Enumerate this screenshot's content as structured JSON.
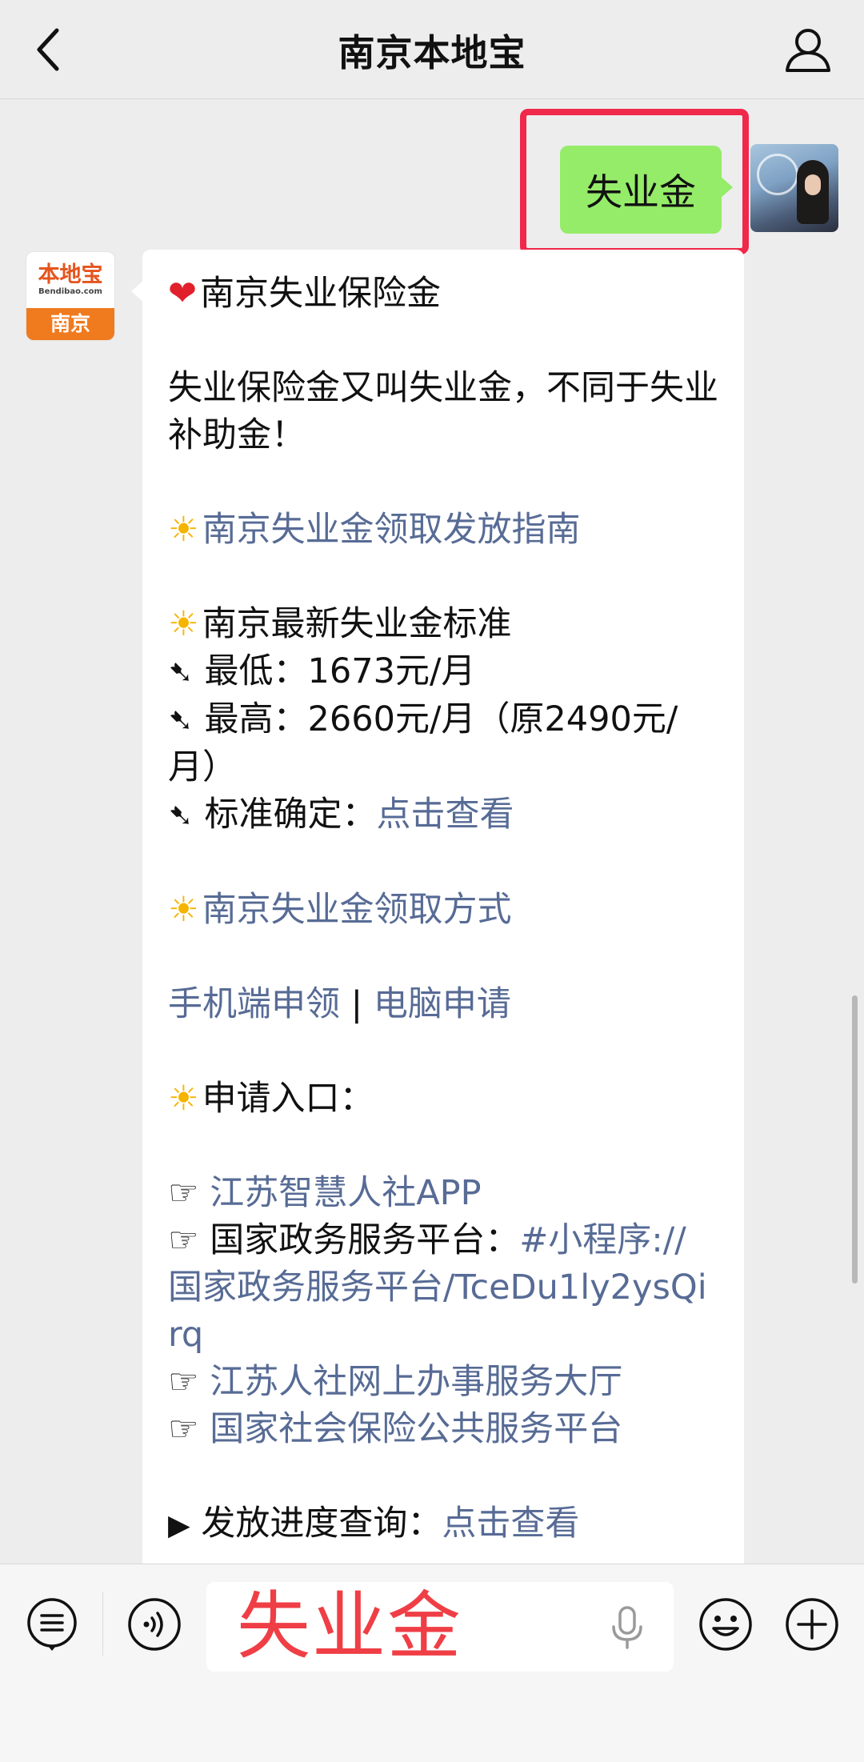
{
  "header": {
    "title": "南京本地宝",
    "back_icon": "chevron-left-icon",
    "profile_icon": "person-icon"
  },
  "user_message": {
    "text": "失业金",
    "highlight_color": "#f0284a",
    "bubble_color": "#95ec69"
  },
  "bot_avatar": {
    "brand": "本地宝",
    "domain": "Bendibao.com",
    "city": "南京"
  },
  "reply": {
    "title": "南京失业保险金",
    "intro": "失业保险金又叫失业金，不同于失业补助金！",
    "guide_link": "南京失业金领取发放指南",
    "standard_heading": "南京最新失业金标准",
    "min_label": "最低：",
    "min_value": "1673元/月",
    "max_label": "最高：",
    "max_value": "2660元/月（原2490元/月）",
    "standard_label": "标准确定：",
    "standard_link": "点击查看",
    "method_link": "南京失业金领取方式",
    "mobile_link": "手机端申领",
    "separator": "|",
    "pc_link": "电脑申请",
    "entry_heading": "申请入口：",
    "entry_1": "江苏智慧人社APP",
    "entry_2_label": "国家政务服务平台：",
    "entry_2_link": "#小程序://国家政务服务平台/TceDu1ly2ysQirq",
    "entry_3": "江苏人社网上办事服务大厅",
    "entry_4": "国家社会保险公共服务平台",
    "progress_label": "发放进度查询：",
    "progress_link": "点击查看",
    "link_color": "#576b95"
  },
  "input_bar": {
    "text": "失业金",
    "menu_icon": "list-menu-icon",
    "voice_icon": "voice-icon",
    "mic_icon": "mic-icon",
    "emoji_icon": "smile-icon",
    "plus_icon": "plus-icon"
  }
}
